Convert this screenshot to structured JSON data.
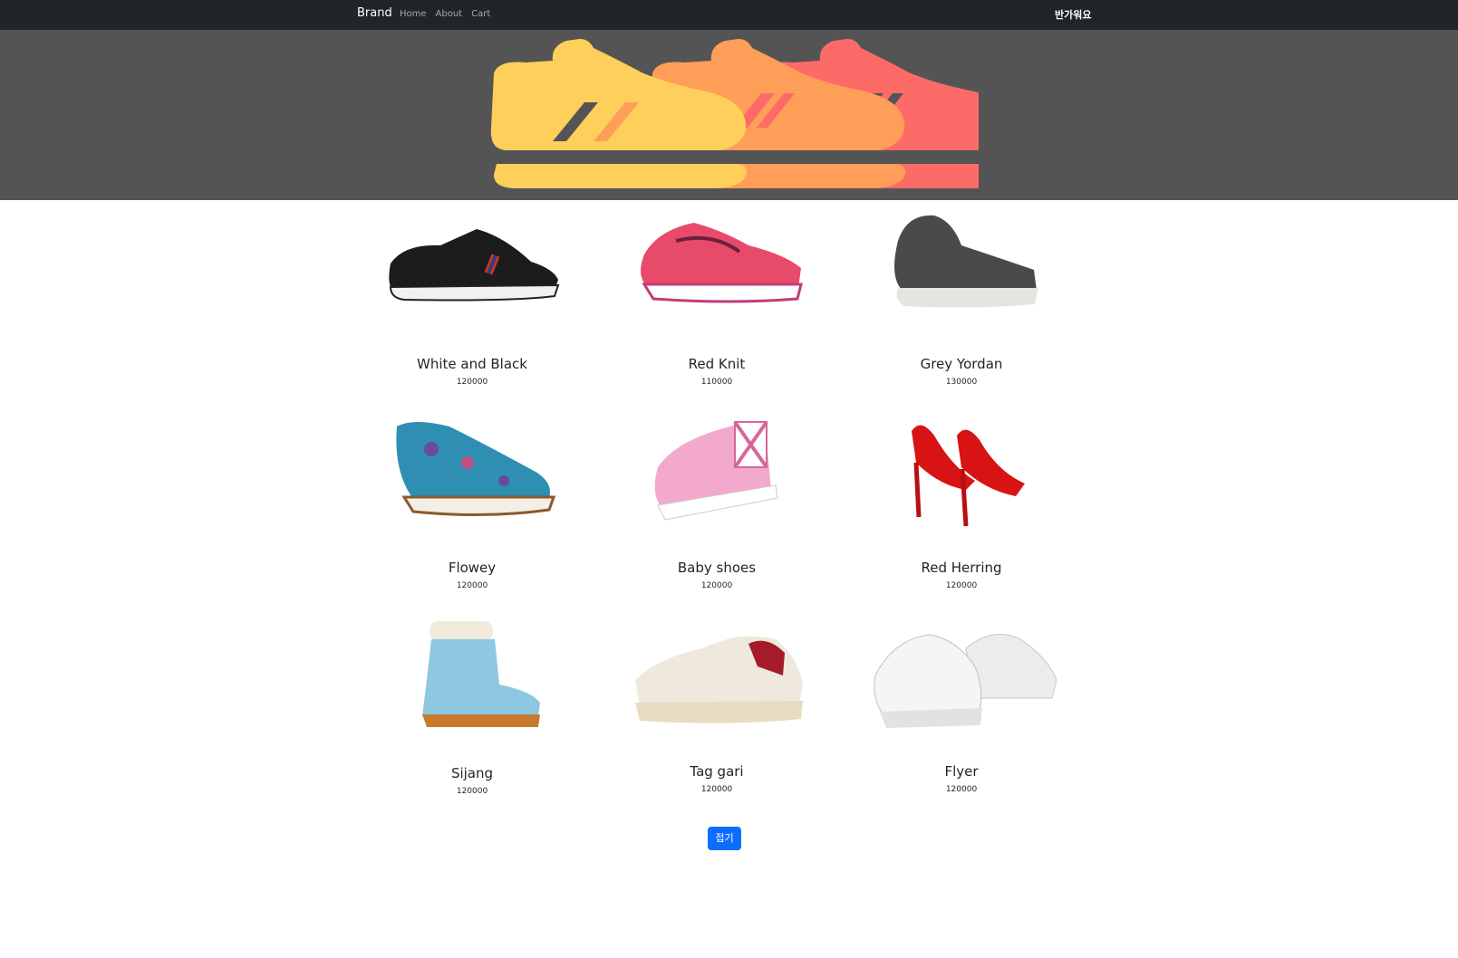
{
  "nav": {
    "brand": "Brand",
    "links": [
      "Home",
      "About",
      "Cart"
    ],
    "greeting": "반가워요"
  },
  "colors": {
    "navbar": "#212529",
    "hero_bg": "#545454",
    "shoe_yellow": "#ffcf5c",
    "shoe_orange": "#ff9e58",
    "shoe_red": "#fd6b68",
    "button": "#0d6efd"
  },
  "products": [
    {
      "name": "White and Black",
      "price": "120000",
      "image": "black-sneaker"
    },
    {
      "name": "Red Knit",
      "price": "110000",
      "image": "red-running-shoe"
    },
    {
      "name": "Grey Yordan",
      "price": "130000",
      "image": "grey-high-top"
    },
    {
      "name": "Flowey",
      "price": "120000",
      "image": "floral-oxford"
    },
    {
      "name": "Baby shoes",
      "price": "120000",
      "image": "pink-slip-on"
    },
    {
      "name": "Red Herring",
      "price": "120000",
      "image": "red-heels"
    },
    {
      "name": "Sijang",
      "price": "120000",
      "image": "blue-boot"
    },
    {
      "name": "Tag gari",
      "price": "120000",
      "image": "chunky-sneaker"
    },
    {
      "name": "Flyer",
      "price": "120000",
      "image": "white-chunky-pair"
    }
  ],
  "fold_button": "접기"
}
